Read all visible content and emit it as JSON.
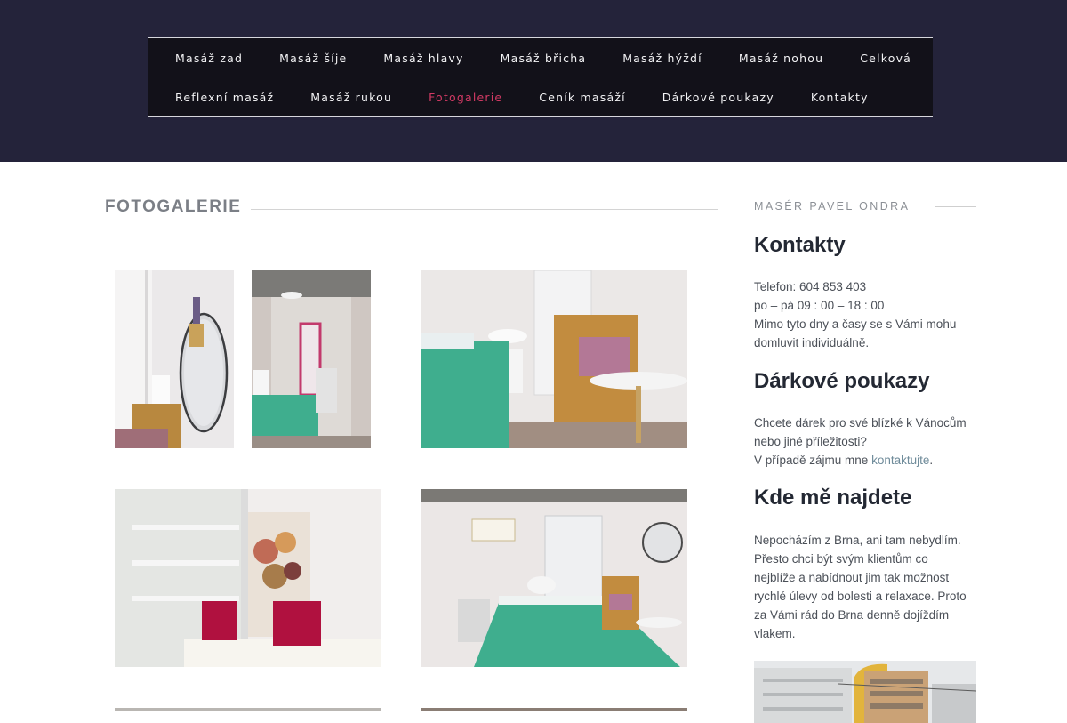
{
  "nav": {
    "row1": [
      "Masáž zad",
      "Masáž šíje",
      "Masáž hlavy",
      "Masáž břicha",
      "Masáž hýždí",
      "Masáž nohou",
      "Celková"
    ],
    "row2": [
      "Reflexní masáž",
      "Masáž rukou",
      "Fotogalerie",
      "Ceník masáží",
      "Dárkové poukazy",
      "Kontakty"
    ],
    "active": "Fotogalerie"
  },
  "main": {
    "title": "FOTOGALERIE"
  },
  "sidebar": {
    "label": "MASÉR PAVEL ONDRA",
    "contacts": {
      "heading": "Kontakty",
      "phone": "Telefon: 604 853 403",
      "hours": "po – pá 09 : 00 – 18 : 00",
      "note_line1": "Mimo tyto dny a časy se s Vámi mohu",
      "note_line2": "domluvit individuálně."
    },
    "vouchers": {
      "heading": "Dárkové poukazy",
      "line1": "Chcete dárek pro své blízké k Vánocům",
      "line2": "nebo jiné příležitosti?",
      "line3_prefix": "V případě zájmu mne ",
      "line3_link": "kontaktujte",
      "line3_suffix": "."
    },
    "location": {
      "heading": "Kde mě najdete",
      "lines": [
        "Nepocházím z Brna, ani tam nebydlím.",
        "Přesto chci být svým klientům co",
        "nejblíže a nabídnout jim tak možnost",
        "rychlé úlevy od bolesti a relaxace. Proto",
        "za Vámi rád do Brna denně dojíždím",
        "vlakem."
      ]
    }
  },
  "colors": {
    "header_bg": "#24233a",
    "nav_bg": "#121119",
    "accent": "#d23a64",
    "towel": "#3fae8e"
  }
}
